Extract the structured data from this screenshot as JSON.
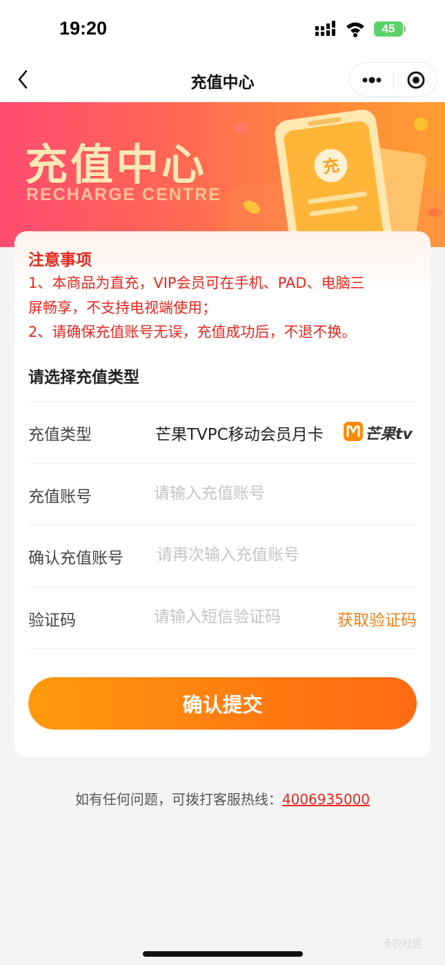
{
  "status_bar": {
    "time": "19:20",
    "battery": "45"
  },
  "nav": {
    "title": "充值中心",
    "back_icon": "chevron-left-icon",
    "more_icon": "more-dots-icon",
    "close_icon": "target-circle-icon"
  },
  "banner": {
    "title": "充值中心",
    "subtitle": "RECHARGE CENTRE",
    "phone_badge": "充"
  },
  "notice": {
    "title": "注意事项",
    "lines": [
      "1、本商品为直充，VIP会员可在手机、PAD、电脑三",
      "屏畅享，不支持电视端使用；",
      "2、请确保充值账号无误，充值成功后，不退不换。"
    ]
  },
  "form": {
    "section_title": "请选择充值类型",
    "type": {
      "label": "充值类型",
      "value": "芒果TVPC移动会员月卡",
      "brand_text": "芒果tv"
    },
    "account": {
      "label": "充值账号",
      "placeholder": "请输入充值账号"
    },
    "confirm_account": {
      "label": "确认充值账号",
      "placeholder": "请再次输入充值账号"
    },
    "code": {
      "label": "验证码",
      "placeholder": "请输入短信验证码",
      "get_code": "获取验证码"
    },
    "submit": "确认提交"
  },
  "footer": {
    "hotline_text": "如有任何问题，可拨打客服热线：",
    "hotline_number": "4006935000",
    "watermark": "卡农社区"
  },
  "colors": {
    "accent_orange": "#ff7a10",
    "notice_red": "#e8261d",
    "banner_gradient_start": "#ff4b70",
    "banner_gradient_end": "#ff9d33"
  }
}
